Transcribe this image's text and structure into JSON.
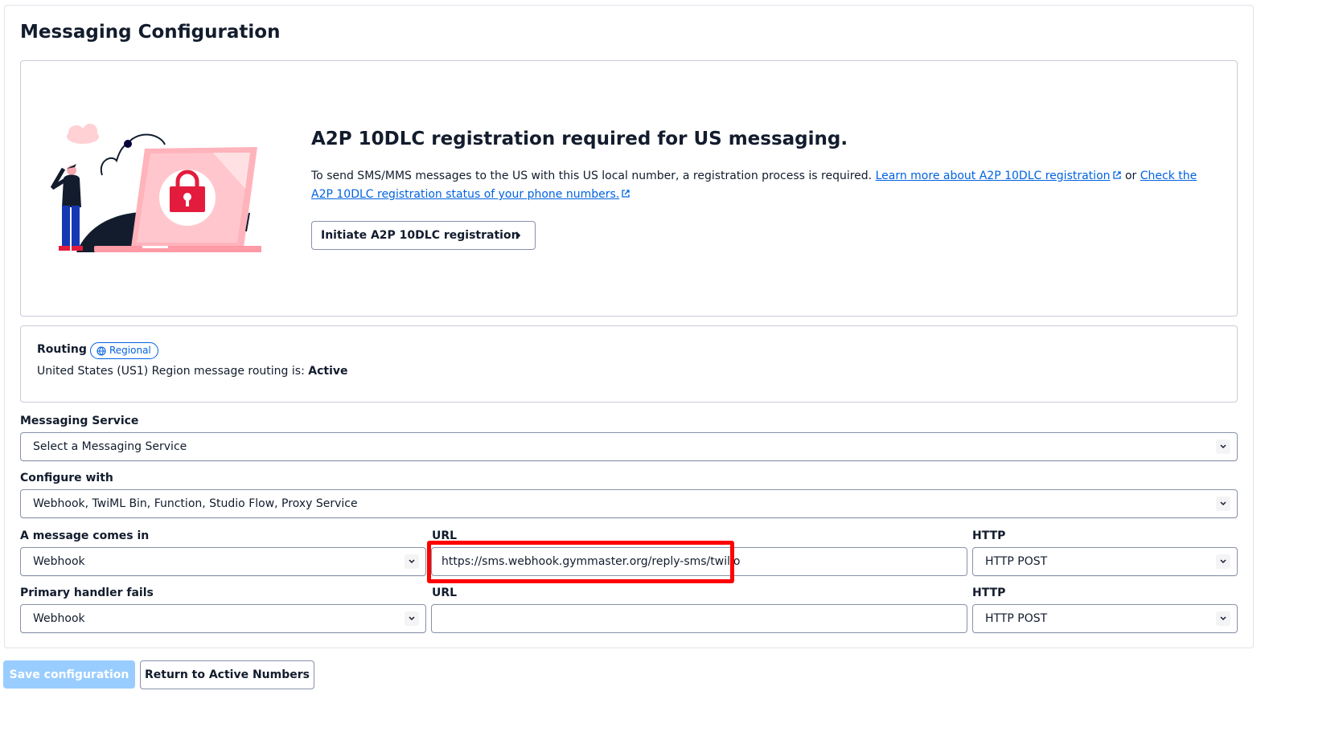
{
  "page": {
    "title": "Messaging Configuration"
  },
  "a2p": {
    "heading": "A2P 10DLC registration required for US messaging.",
    "body_text": "To send SMS/MMS messages to the US with this US local number, a registration process is required.",
    "learn_more_link": "Learn more about A2P 10DLC registration",
    "or_text": "or",
    "check_status_link": "Check the A2P 10DLC registration status of your phone numbers.",
    "button_label": "Initiate A2P 10DLC registration",
    "icons": {
      "illustration": "locked-laptop-illustration",
      "external": "external-link-icon",
      "chevron": "chevron-right-icon"
    }
  },
  "routing": {
    "label": "Routing",
    "badge": "Regional",
    "badge_icon": "globe-icon",
    "status_prefix": "United States (US1) Region message routing is:",
    "status_value": "Active"
  },
  "messaging_service": {
    "label": "Messaging Service",
    "selected": "Select a Messaging Service"
  },
  "configure_with": {
    "label": "Configure with",
    "selected": "Webhook, TwiML Bin, Function, Studio Flow, Proxy Service"
  },
  "incoming": {
    "label": "A message comes in",
    "handler": "Webhook",
    "url_label": "URL",
    "url_value": "https://sms.webhook.gymmaster.org/reply-sms/twilio",
    "http_label": "HTTP",
    "http_method": "HTTP POST"
  },
  "fallback": {
    "label": "Primary handler fails",
    "handler": "Webhook",
    "url_label": "URL",
    "url_value": "",
    "http_label": "HTTP",
    "http_method": "HTTP POST"
  },
  "actions": {
    "save_label": "Save configuration",
    "return_label": "Return to Active Numbers"
  },
  "colors": {
    "accent": "#0263e0",
    "highlight": "#ff0000",
    "disabled_button": "#99cdff"
  }
}
